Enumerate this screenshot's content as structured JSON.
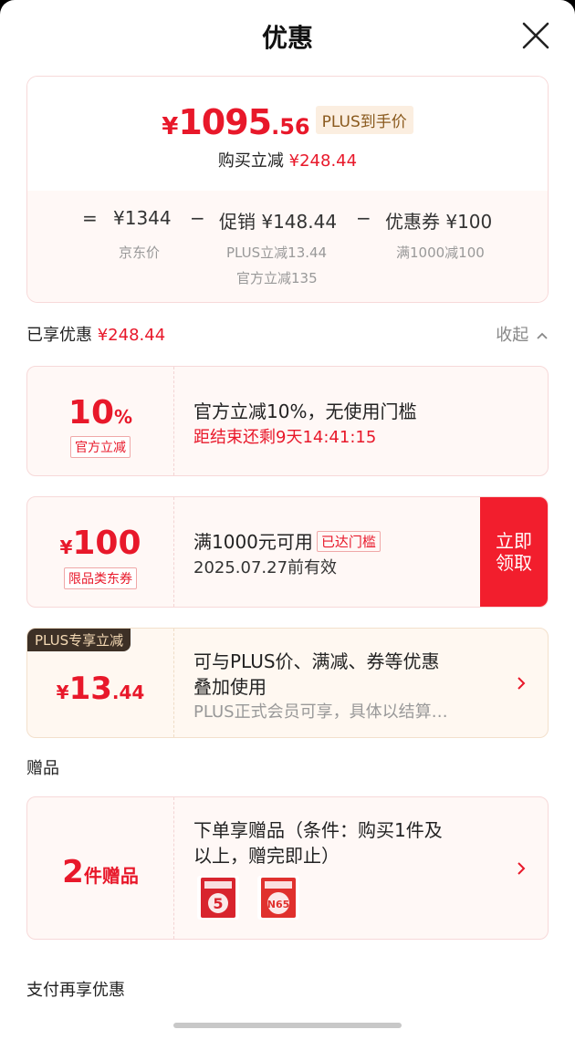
{
  "header": {
    "title": "优惠"
  },
  "summary": {
    "price_yen": "¥",
    "price_int": "1095",
    "price_dec": ".56",
    "plus_badge": "PLUS到手价",
    "discount_label": "购买立减",
    "discount_value": "¥248.44",
    "formula": {
      "eq": "=",
      "jd_price": "¥1344",
      "minus1": "−",
      "promo": "促销 ¥148.44",
      "minus2": "−",
      "coupon": "优惠券 ¥100",
      "jd_price_label": "京东价",
      "promo_sub1": "PLUS立减13.44",
      "promo_sub2": "官方立减135",
      "coupon_sub": "满1000减100"
    }
  },
  "enjoyed": {
    "label": "已享优惠",
    "value": "¥248.44",
    "collapse": "收起"
  },
  "coupons": {
    "official": {
      "value_num": "10",
      "value_unit": "%",
      "tag": "官方立减",
      "title": "官方立减10%，无使用门槛",
      "countdown": "距结束还剩9天14:41:15"
    },
    "jd_coupon": {
      "yen": "¥",
      "value": "100",
      "tag": "限品类东券",
      "title": "满1000元可用",
      "reached": "已达门槛",
      "validity": "2025.07.27前有效",
      "claim_line1": "立即",
      "claim_line2": "领取"
    },
    "plus": {
      "tag": "PLUS专享立减",
      "yen": "¥",
      "int": "13",
      "dec": ".44",
      "line1": "可与PLUS价、满减、券等优惠",
      "line2": "叠加使用",
      "line3": "PLUS正式会员可享，具体以结算…"
    }
  },
  "gifts": {
    "section": "赠品",
    "count": "2",
    "count_unit": "件赠品",
    "line1": "下单享赠品（条件：购买1件及",
    "line2": "以上，赠完即止）",
    "items": [
      {
        "icon": "gift-image-1",
        "label": "5"
      },
      {
        "icon": "gift-image-2",
        "label": "N65"
      }
    ]
  },
  "payment": {
    "section": "支付再享优惠"
  },
  "colors": {
    "accent": "#e8182a",
    "claim": "#f21e2d",
    "plus_dark": "#3d3026"
  }
}
